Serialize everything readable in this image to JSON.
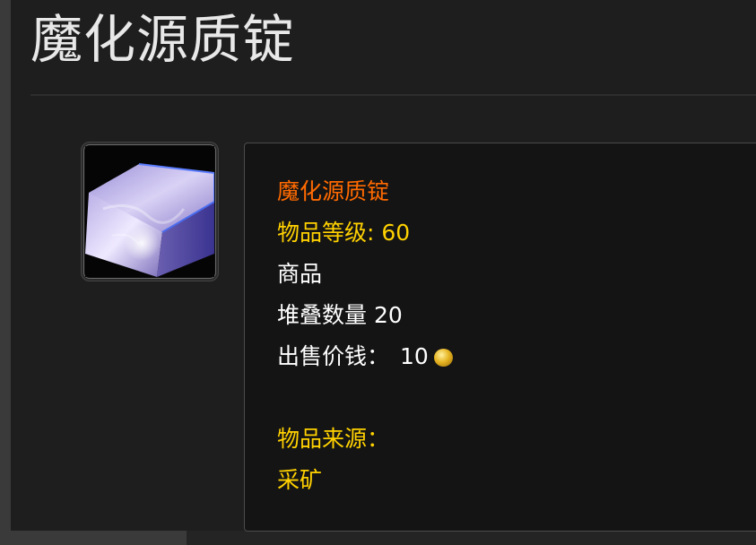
{
  "page": {
    "title": "魔化源质锭"
  },
  "item": {
    "icon": "enchanted-ingot-icon",
    "name": "魔化源质锭",
    "level_label": "物品等级:",
    "level_value": "60",
    "type": "商品",
    "stack_label": "堆叠数量",
    "stack_value": "20",
    "price_label": "出售价钱：",
    "price_value": "10",
    "price_currency_icon": "gold-coin-icon",
    "source_label": "物品来源：",
    "source_value": "采矿"
  },
  "colors": {
    "item_name": "#ff6a00",
    "gold_text": "#ffd100",
    "white_text": "#ffffff",
    "background": "#1e1e1e",
    "tooltip_bg": "#141414"
  }
}
